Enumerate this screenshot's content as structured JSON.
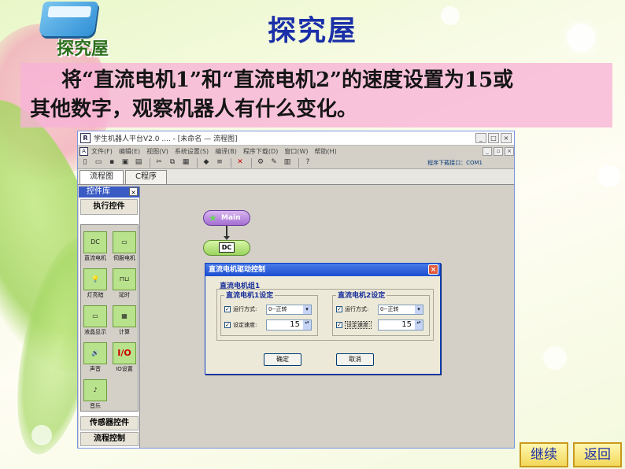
{
  "slide": {
    "logo_text": "探究屋",
    "title": "探究屋",
    "instruction_line1": "将“直流电机1”和“直流电机2”的速度设置为15或",
    "instruction_line2": "其他数字，观察机器人有什么变化。"
  },
  "app": {
    "window_title": "学生机器人平台V2.0 .... - [未命名 — 流程图]",
    "menu": [
      "文件(F)",
      "编辑(E)",
      "视图(V)",
      "系统设置(S)",
      "编译(B)",
      "程序下载(D)",
      "窗口(W)",
      "帮助(H)"
    ],
    "port_status": "程序下载接口：COM1",
    "tabs": [
      "流程图",
      "C程序"
    ],
    "panel": {
      "header": "控件库",
      "section_exec": "执行控件",
      "controls": [
        {
          "label": "直流电机",
          "icon": "DC"
        },
        {
          "label": "伺服电机",
          "icon": ""
        },
        {
          "label": "灯亮暗",
          "icon": "💡"
        },
        {
          "label": "延时",
          "icon": ""
        },
        {
          "label": "液晶显示",
          "icon": ""
        },
        {
          "label": "计算",
          "icon": ""
        },
        {
          "label": "声音",
          "icon": "🔊"
        },
        {
          "label": "IO设置",
          "icon": "I/O"
        },
        {
          "label": "音乐",
          "icon": "♪"
        }
      ],
      "section_sensor": "传感器控件",
      "section_flow": "流程控制"
    },
    "flow": {
      "main_label": "Main",
      "dc_label": "DC"
    },
    "dialog": {
      "title": "直流电机驱动控制",
      "group_label": "直流电机组1",
      "motor1": {
        "legend": "直流电机1设定",
        "mode_label": "运行方式:",
        "mode_value": "0--正转",
        "speed_label": "设定速度:",
        "speed_value": "15"
      },
      "motor2": {
        "legend": "直流电机2设定",
        "mode_label": "运行方式:",
        "mode_value": "0--正转",
        "speed_label": "设定速度:",
        "speed_value": "15"
      },
      "ok_label": "确定",
      "cancel_label": "取消"
    }
  },
  "nav": {
    "continue_label": "继续",
    "back_label": "返回"
  }
}
